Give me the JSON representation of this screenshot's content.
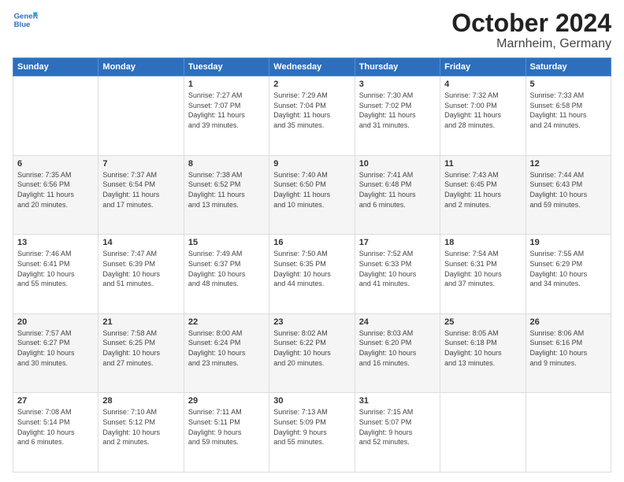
{
  "header": {
    "logo_line1": "General",
    "logo_line2": "Blue",
    "title": "October 2024",
    "location": "Marnheim, Germany"
  },
  "calendar": {
    "days_of_week": [
      "Sunday",
      "Monday",
      "Tuesday",
      "Wednesday",
      "Thursday",
      "Friday",
      "Saturday"
    ],
    "weeks": [
      [
        {
          "day": "",
          "info": ""
        },
        {
          "day": "",
          "info": ""
        },
        {
          "day": "1",
          "info": "Sunrise: 7:27 AM\nSunset: 7:07 PM\nDaylight: 11 hours\nand 39 minutes."
        },
        {
          "day": "2",
          "info": "Sunrise: 7:29 AM\nSunset: 7:04 PM\nDaylight: 11 hours\nand 35 minutes."
        },
        {
          "day": "3",
          "info": "Sunrise: 7:30 AM\nSunset: 7:02 PM\nDaylight: 11 hours\nand 31 minutes."
        },
        {
          "day": "4",
          "info": "Sunrise: 7:32 AM\nSunset: 7:00 PM\nDaylight: 11 hours\nand 28 minutes."
        },
        {
          "day": "5",
          "info": "Sunrise: 7:33 AM\nSunset: 6:58 PM\nDaylight: 11 hours\nand 24 minutes."
        }
      ],
      [
        {
          "day": "6",
          "info": "Sunrise: 7:35 AM\nSunset: 6:56 PM\nDaylight: 11 hours\nand 20 minutes."
        },
        {
          "day": "7",
          "info": "Sunrise: 7:37 AM\nSunset: 6:54 PM\nDaylight: 11 hours\nand 17 minutes."
        },
        {
          "day": "8",
          "info": "Sunrise: 7:38 AM\nSunset: 6:52 PM\nDaylight: 11 hours\nand 13 minutes."
        },
        {
          "day": "9",
          "info": "Sunrise: 7:40 AM\nSunset: 6:50 PM\nDaylight: 11 hours\nand 10 minutes."
        },
        {
          "day": "10",
          "info": "Sunrise: 7:41 AM\nSunset: 6:48 PM\nDaylight: 11 hours\nand 6 minutes."
        },
        {
          "day": "11",
          "info": "Sunrise: 7:43 AM\nSunset: 6:45 PM\nDaylight: 11 hours\nand 2 minutes."
        },
        {
          "day": "12",
          "info": "Sunrise: 7:44 AM\nSunset: 6:43 PM\nDaylight: 10 hours\nand 59 minutes."
        }
      ],
      [
        {
          "day": "13",
          "info": "Sunrise: 7:46 AM\nSunset: 6:41 PM\nDaylight: 10 hours\nand 55 minutes."
        },
        {
          "day": "14",
          "info": "Sunrise: 7:47 AM\nSunset: 6:39 PM\nDaylight: 10 hours\nand 51 minutes."
        },
        {
          "day": "15",
          "info": "Sunrise: 7:49 AM\nSunset: 6:37 PM\nDaylight: 10 hours\nand 48 minutes."
        },
        {
          "day": "16",
          "info": "Sunrise: 7:50 AM\nSunset: 6:35 PM\nDaylight: 10 hours\nand 44 minutes."
        },
        {
          "day": "17",
          "info": "Sunrise: 7:52 AM\nSunset: 6:33 PM\nDaylight: 10 hours\nand 41 minutes."
        },
        {
          "day": "18",
          "info": "Sunrise: 7:54 AM\nSunset: 6:31 PM\nDaylight: 10 hours\nand 37 minutes."
        },
        {
          "day": "19",
          "info": "Sunrise: 7:55 AM\nSunset: 6:29 PM\nDaylight: 10 hours\nand 34 minutes."
        }
      ],
      [
        {
          "day": "20",
          "info": "Sunrise: 7:57 AM\nSunset: 6:27 PM\nDaylight: 10 hours\nand 30 minutes."
        },
        {
          "day": "21",
          "info": "Sunrise: 7:58 AM\nSunset: 6:25 PM\nDaylight: 10 hours\nand 27 minutes."
        },
        {
          "day": "22",
          "info": "Sunrise: 8:00 AM\nSunset: 6:24 PM\nDaylight: 10 hours\nand 23 minutes."
        },
        {
          "day": "23",
          "info": "Sunrise: 8:02 AM\nSunset: 6:22 PM\nDaylight: 10 hours\nand 20 minutes."
        },
        {
          "day": "24",
          "info": "Sunrise: 8:03 AM\nSunset: 6:20 PM\nDaylight: 10 hours\nand 16 minutes."
        },
        {
          "day": "25",
          "info": "Sunrise: 8:05 AM\nSunset: 6:18 PM\nDaylight: 10 hours\nand 13 minutes."
        },
        {
          "day": "26",
          "info": "Sunrise: 8:06 AM\nSunset: 6:16 PM\nDaylight: 10 hours\nand 9 minutes."
        }
      ],
      [
        {
          "day": "27",
          "info": "Sunrise: 7:08 AM\nSunset: 5:14 PM\nDaylight: 10 hours\nand 6 minutes."
        },
        {
          "day": "28",
          "info": "Sunrise: 7:10 AM\nSunset: 5:12 PM\nDaylight: 10 hours\nand 2 minutes."
        },
        {
          "day": "29",
          "info": "Sunrise: 7:11 AM\nSunset: 5:11 PM\nDaylight: 9 hours\nand 59 minutes."
        },
        {
          "day": "30",
          "info": "Sunrise: 7:13 AM\nSunset: 5:09 PM\nDaylight: 9 hours\nand 55 minutes."
        },
        {
          "day": "31",
          "info": "Sunrise: 7:15 AM\nSunset: 5:07 PM\nDaylight: 9 hours\nand 52 minutes."
        },
        {
          "day": "",
          "info": ""
        },
        {
          "day": "",
          "info": ""
        }
      ]
    ]
  }
}
